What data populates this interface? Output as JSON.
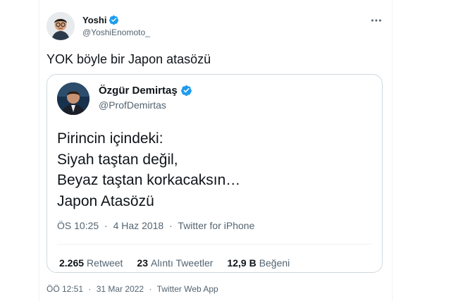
{
  "tweet": {
    "author": {
      "name": "Yoshi",
      "handle": "@YoshiEnomoto_",
      "verified": true
    },
    "more_icon": "more-horizontal-icon",
    "text": "YOK böyle bir Japon atasözü",
    "time": "ÖÖ 12:51",
    "date": "31 Mar 2022",
    "source": "Twitter Web App",
    "separator": "·"
  },
  "quoted": {
    "author": {
      "name": "Özgür Demirtaş",
      "handle": "@ProfDemirtas",
      "verified": true
    },
    "lines": [
      "Pirincin içindeki:",
      "Siyah taştan değil,",
      "Beyaz taştan korkacaksın…",
      "Japon Atasözü"
    ],
    "time": "ÖS 10:25",
    "date": "4 Haz 2018",
    "source": "Twitter for iPhone",
    "separator": "·",
    "stats": {
      "retweets": {
        "value": "2.265",
        "label": "Retweet"
      },
      "quotes": {
        "value": "23",
        "label": "Alıntı Tweetler"
      },
      "likes": {
        "value": "12,9 B",
        "label": "Beğeni"
      }
    }
  },
  "colors": {
    "text": "#0f1419",
    "secondary": "#536471",
    "border": "#cfd9de",
    "verified": "#1d9bf0"
  }
}
